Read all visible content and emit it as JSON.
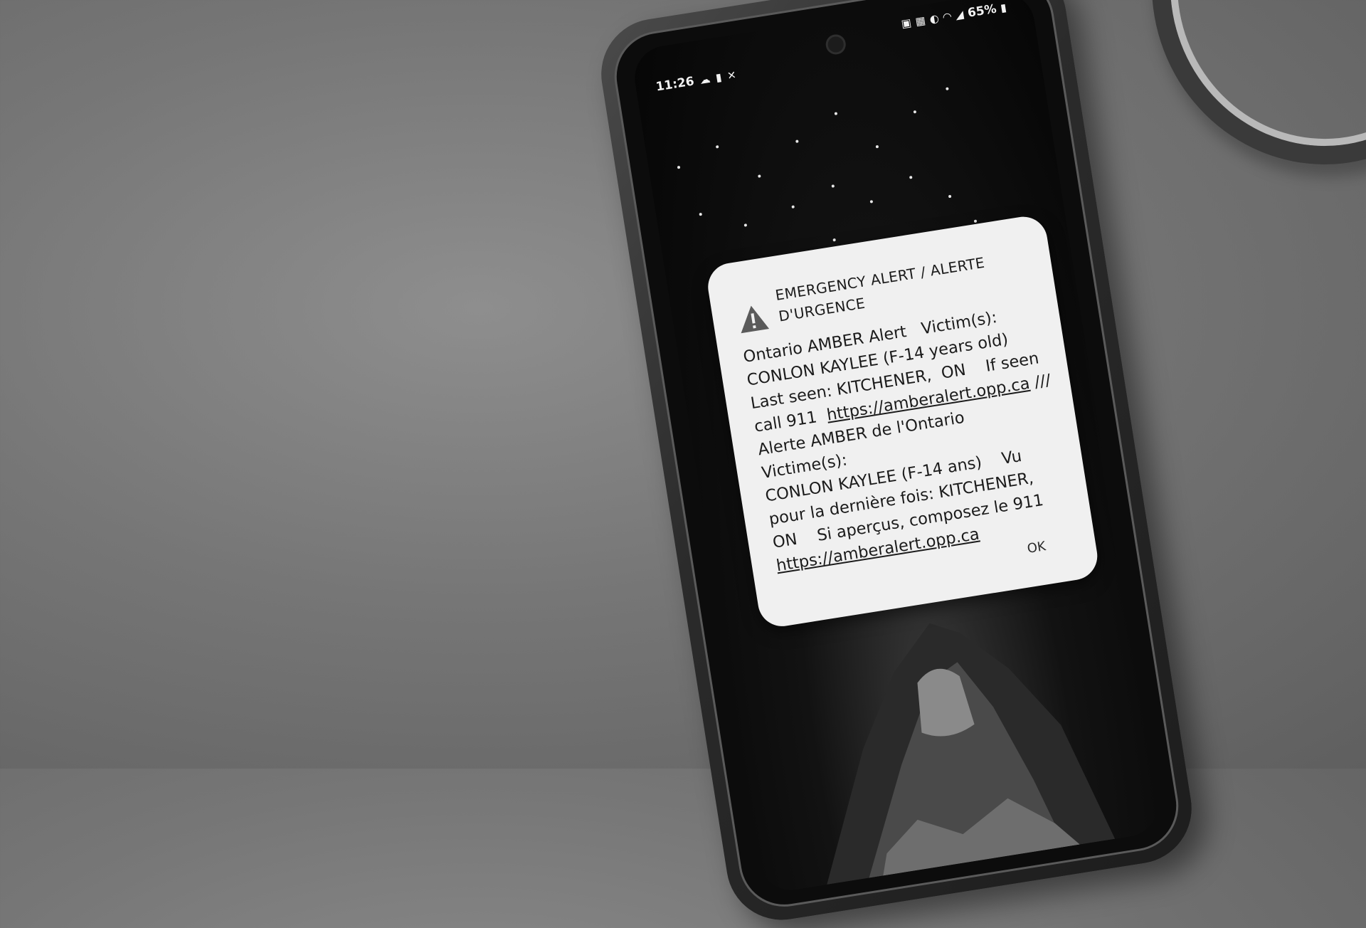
{
  "status_bar": {
    "time": "11:26",
    "battery": "65%",
    "left_icons": [
      "cloud-icon",
      "battery-saver-icon",
      "x-app-icon"
    ],
    "right_icons": [
      "lock-icon",
      "photo-icon",
      "data-saver-icon",
      "wifi-icon",
      "signal-icon",
      "battery-icon"
    ]
  },
  "alert": {
    "icon": "warning-triangle-icon",
    "title_line1": "EMERGENCY ALERT / ALERTE",
    "title_line2": "D'URGENCE",
    "body": {
      "l1": "Ontario AMBER Alert   Victim(s):",
      "l2": "CONLON KAYLEE (F-14 years old)",
      "l3": "Last seen: KITCHENER,  ON    If seen",
      "l4_prefix": "call 911  ",
      "link1": "https://amberalert.opp.ca",
      "l4_suffix": " ///",
      "l5": "Alerte AMBER de l'Ontario   Victime(s):",
      "l6": "CONLON KAYLEE (F-14 ans)    Vu",
      "l7": "pour la dernière fois: KITCHENER,",
      "l8": "ON    Si aperçus, composez le 911",
      "link2": "https://amberalert.opp.ca"
    },
    "ok_label": "OK"
  },
  "colors": {
    "background": "#767676",
    "phone_case": "#2b2b2b",
    "dialog": "#f0f0f0",
    "dialog_text": "#1b1b1b"
  }
}
